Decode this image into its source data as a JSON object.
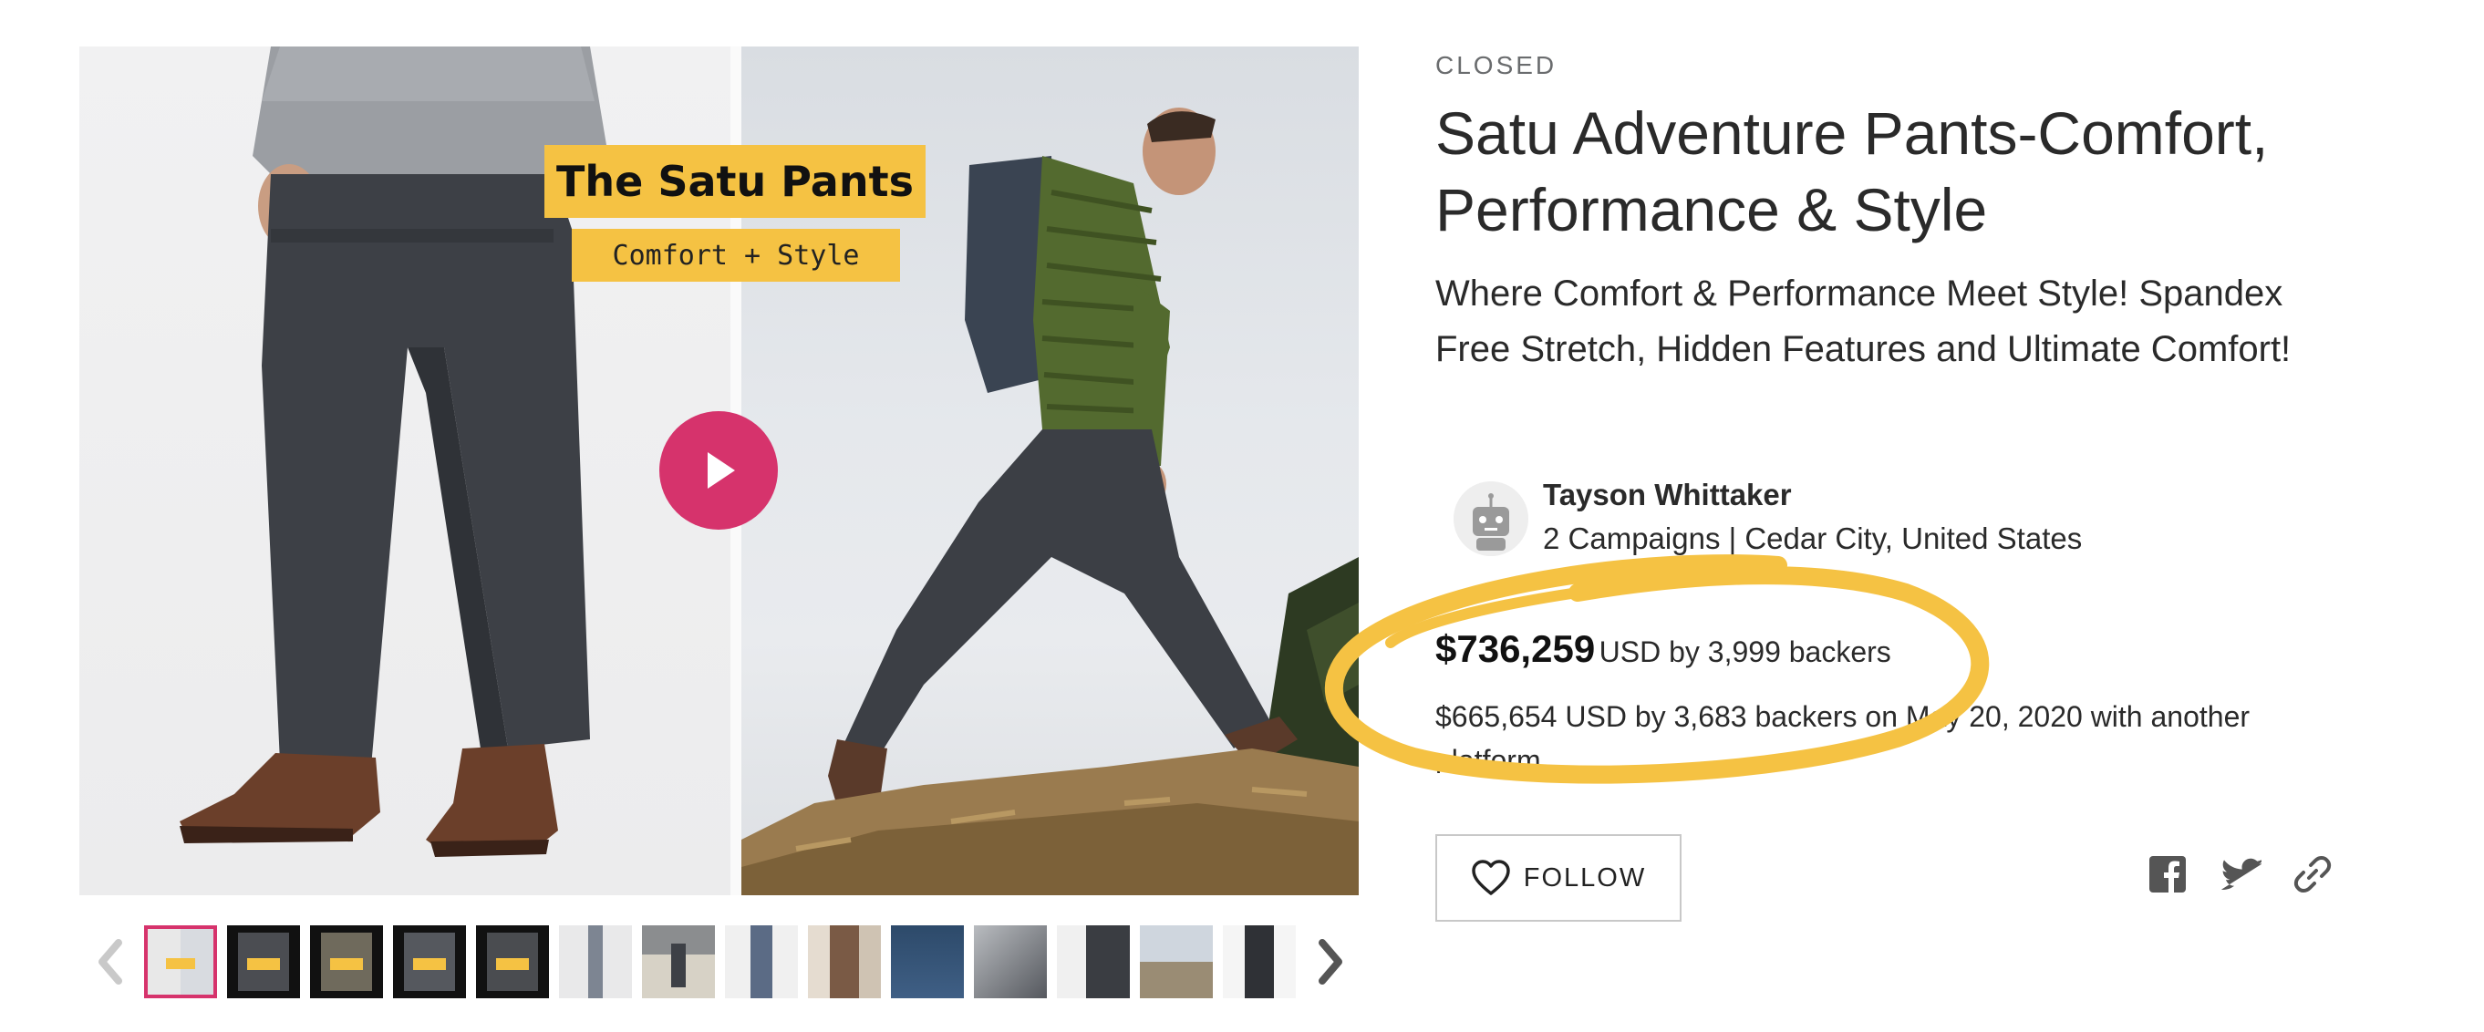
{
  "media": {
    "overlay_title": "The Satu Pants",
    "overlay_subtitle": "Comfort + Style"
  },
  "campaign": {
    "status": "CLOSED",
    "title": "Satu Adventure Pants-Comfort, Performance & Style",
    "tagline": "Where Comfort & Performance Meet Style! Spandex Free Stretch, Hidden Features and Ultimate Comfort!"
  },
  "owner": {
    "name": "Tayson Whittaker",
    "meta": "2 Campaigns | Cedar City, United States"
  },
  "funding": {
    "amount": "$736,259",
    "detail": "USD by 3,999 backers",
    "other_platform": "$665,654 USD by 3,683 backers on May 20, 2020 with another platform"
  },
  "actions": {
    "follow_label": "FOLLOW"
  },
  "colors": {
    "accent": "#d6336c",
    "highlight": "#f5c243",
    "text": "#2a2a2a"
  },
  "icons": {
    "play": "play-icon",
    "heart": "heart-icon",
    "facebook": "facebook-icon",
    "twitter": "twitter-icon",
    "link": "link-icon"
  }
}
